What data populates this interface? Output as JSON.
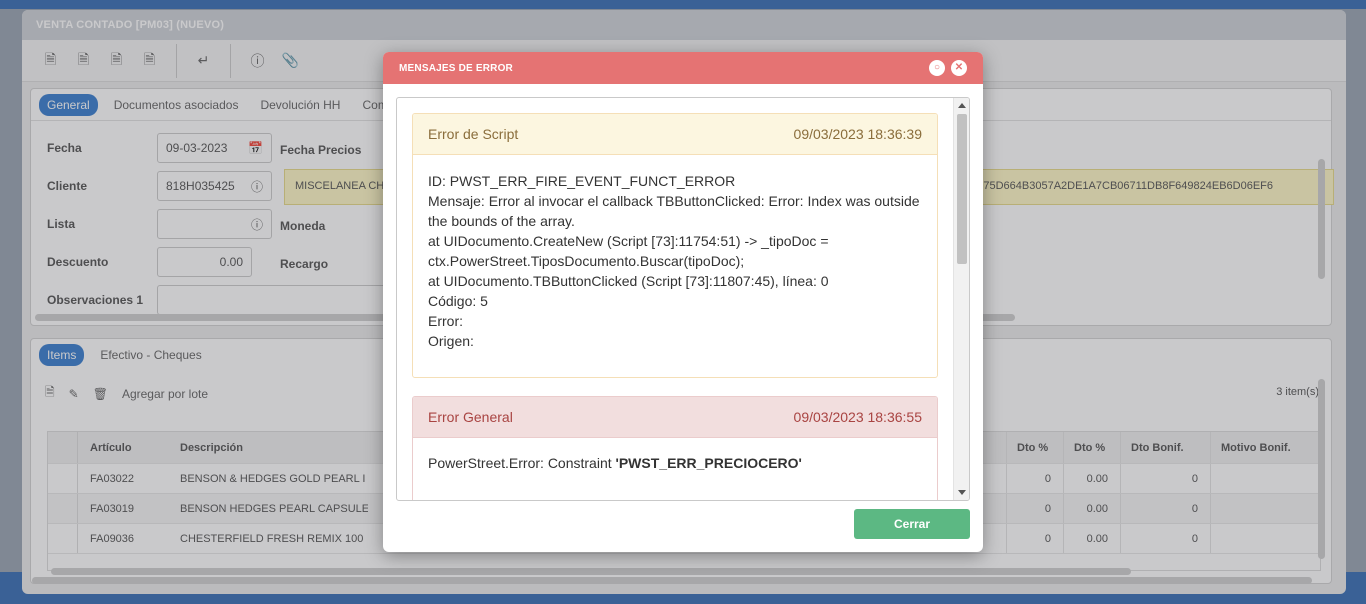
{
  "app": {
    "window_title": "VENTA CONTADO [PM03] (NUEVO)",
    "header_tabs": [
      {
        "label": "General"
      },
      {
        "label": "Documentos asociados"
      },
      {
        "label": "Devolución HH"
      },
      {
        "label": "Comenta"
      }
    ],
    "form": {
      "fecha_label": "Fecha",
      "fecha_value": "09-03-2023",
      "fecha_precios_label": "Fecha Precios",
      "cliente_label": "Cliente",
      "cliente_value": "818H035425",
      "cliente_name": "MISCELANEA CHI",
      "hash_text": "21575D664B3057A2DE1A7CB06711DB8F649824EB6D06EF6",
      "lista_label": "Lista",
      "moneda_label": "Moneda",
      "descuento_label": "Descuento",
      "descuento_value": "0.00",
      "recargo_label": "Recargo",
      "observaciones_label": "Observaciones 1"
    },
    "items_tabs": [
      {
        "label": "Items"
      },
      {
        "label": "Efectivo - Cheques"
      }
    ],
    "items_tools": {
      "agregar_label": "Agregar por lote",
      "count": "3 item(s)"
    },
    "grid": {
      "headers": {
        "articulo": "Artículo",
        "descripcion": "Descripción",
        "dto_pct_1": "Dto %",
        "dto_pct_2": "Dto %",
        "dto_bonif": "Dto Bonif.",
        "motivo_bonif": "Motivo Bonif."
      },
      "rows": [
        {
          "articulo": "FA03022",
          "descripcion": "BENSON & HEDGES GOLD PEARL I",
          "d1": "0",
          "d2": "0.00",
          "d3": "0"
        },
        {
          "articulo": "FA03019",
          "descripcion": "BENSON HEDGES PEARL CAPSULE",
          "d1": "0",
          "d2": "0.00",
          "d3": "0"
        },
        {
          "articulo": "FA09036",
          "descripcion": "CHESTERFIELD FRESH REMIX 100",
          "d1": "0",
          "d2": "0.00",
          "d3": "0"
        }
      ]
    }
  },
  "modal": {
    "title": "MENSAJES DE ERROR",
    "close_label": "Cerrar",
    "messages": [
      {
        "type": "Error de Script",
        "timestamp": "09/03/2023 18:36:39",
        "lines": [
          "ID: PWST_ERR_FIRE_EVENT_FUNCT_ERROR",
          "Mensaje: Error al invocar el callback TBButtonClicked: Error: Index was outside the bounds of the array.",
          "at UIDocumento.CreateNew (Script [73]:11754:51) -> _tipoDoc = ctx.PowerStreet.TiposDocumento.Buscar(tipoDoc);",
          "at UIDocumento.TBButtonClicked (Script [73]:11807:45), línea: 0",
          "Código: 5",
          "Error:",
          "Origen:"
        ]
      },
      {
        "type": "Error General",
        "timestamp": "09/03/2023 18:36:55",
        "prefix": "PowerStreet.Error: Constraint ",
        "constraint": "'PWST_ERR_PRECIOCERO'"
      }
    ]
  },
  "colors": {
    "modal_header": "#e57373",
    "accent_blue": "#3a7fd0",
    "cerrar_button": "#5cb883",
    "warning_bg": "#fcf6e0",
    "error_bg": "#f2dede"
  }
}
